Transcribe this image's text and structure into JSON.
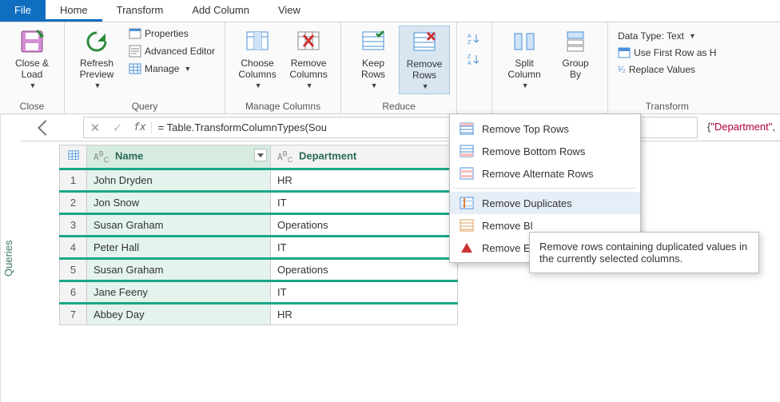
{
  "tabs": {
    "file": "File",
    "home": "Home",
    "transform": "Transform",
    "addcol": "Add Column",
    "view": "View"
  },
  "ribbon": {
    "close": {
      "close_load": "Close &\nLoad",
      "group": "Close"
    },
    "query": {
      "refresh": "Refresh\nPreview",
      "properties": "Properties",
      "adv_editor": "Advanced Editor",
      "manage": "Manage",
      "group": "Query"
    },
    "manage_cols": {
      "choose": "Choose\nColumns",
      "remove": "Remove\nColumns",
      "group": "Manage Columns"
    },
    "reduce": {
      "keep": "Keep\nRows",
      "remove": "Remove\nRows",
      "group": "Reduce"
    },
    "sort": {
      "asc": "A→Z",
      "desc": "Z→A"
    },
    "split_group": {
      "split": "Split\nColumn",
      "groupby": "Group\nBy"
    },
    "transform": {
      "datatype": "Data Type: Text",
      "first_row": "Use First Row as H",
      "replace": "Replace Values",
      "group": "Transform"
    }
  },
  "formula": {
    "prefix": "= ",
    "fn": "Table.TransformColumnTypes",
    "arg_start": "(Sou",
    "tail_brace": "{",
    "tail_str": "\"Department\"",
    "tail_after": ", "
  },
  "columns": {
    "name": "Name",
    "dept": "Department"
  },
  "rows": [
    {
      "n": "1",
      "name": "John Dryden",
      "dept": "HR"
    },
    {
      "n": "2",
      "name": "Jon Snow",
      "dept": "IT"
    },
    {
      "n": "3",
      "name": "Susan Graham",
      "dept": "Operations"
    },
    {
      "n": "4",
      "name": "Peter Hall",
      "dept": "IT"
    },
    {
      "n": "5",
      "name": "Susan Graham",
      "dept": "Operations"
    },
    {
      "n": "6",
      "name": "Jane Feeny",
      "dept": "IT"
    },
    {
      "n": "7",
      "name": "Abbey Day",
      "dept": "HR"
    }
  ],
  "menu": {
    "top": "Remove Top Rows",
    "bottom": "Remove Bottom Rows",
    "alt": "Remove Alternate Rows",
    "dup": "Remove Duplicates",
    "blank": "Remove Bl",
    "err": "Remove Er"
  },
  "tooltip": "Remove rows containing duplicated values in the currently selected columns.",
  "sidebar": {
    "queries": "Queries"
  }
}
